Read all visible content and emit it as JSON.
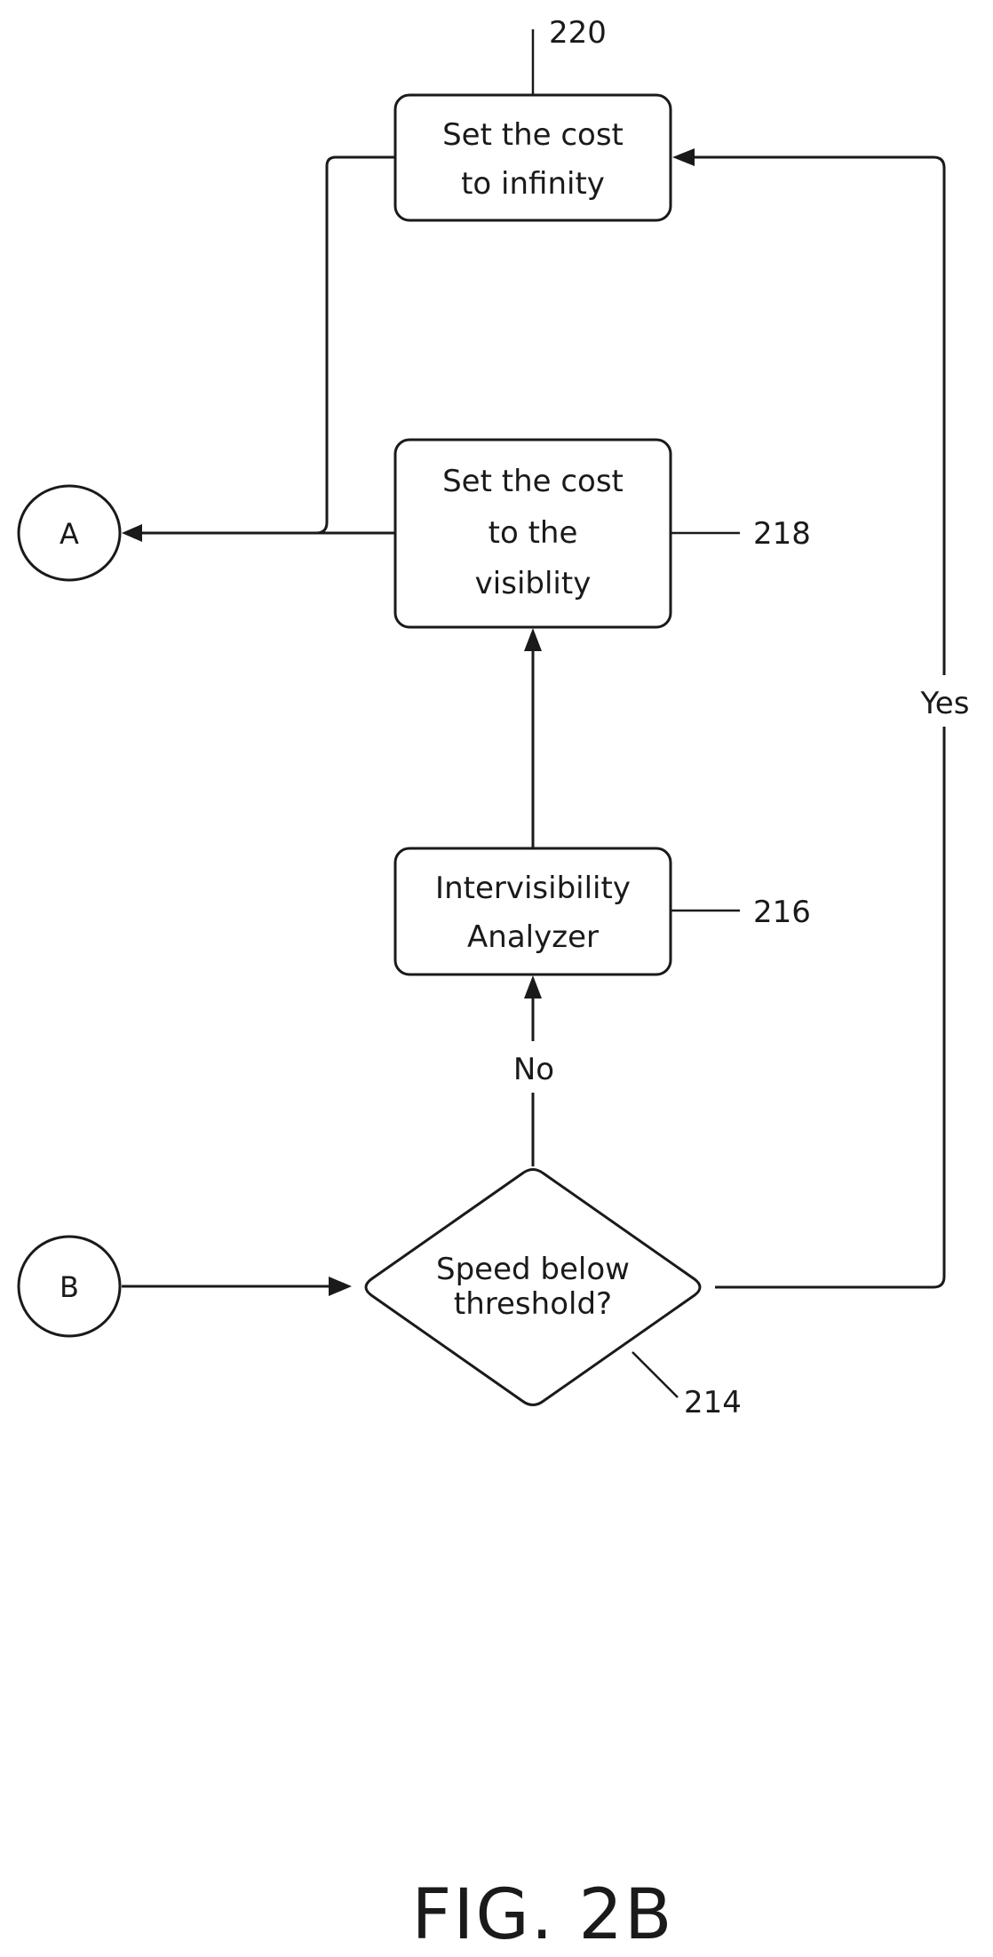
{
  "figure": {
    "title": "FIG. 2B"
  },
  "connectors": {
    "a": {
      "label": "A"
    },
    "b": {
      "label": "B"
    }
  },
  "nodes": {
    "n220": {
      "ref": "220",
      "lines": [
        "Set the cost",
        "to infinity"
      ]
    },
    "n218": {
      "ref": "218",
      "lines": [
        "Set the cost",
        "to the",
        "visiblity"
      ]
    },
    "n216": {
      "ref": "216",
      "lines": [
        "Intervisibility",
        "Analyzer"
      ]
    },
    "n214": {
      "ref": "214",
      "lines": [
        "Speed below",
        "threshold?"
      ]
    }
  },
  "edges": {
    "no_label": "No",
    "yes_label": "Yes"
  }
}
